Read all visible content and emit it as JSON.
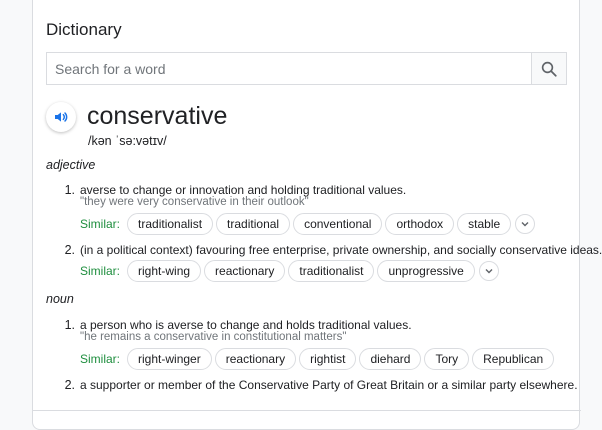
{
  "dictionary": {
    "title": "Dictionary",
    "search_placeholder": "Search for a word",
    "word": "conservative",
    "phonetic": "/kən ˈsə:vətɪv/",
    "similar_label": "Similar:",
    "entries": [
      {
        "pos": "adjective",
        "senses": [
          {
            "num": "1.",
            "definition": "averse to change or innovation and holding traditional values.",
            "example": "\"they were very conservative in their outlook\"",
            "similar": [
              "traditionalist",
              "traditional",
              "conventional",
              "orthodox",
              "stable"
            ]
          },
          {
            "num": "2.",
            "definition": "(in a political context) favouring free enterprise, private ownership, and socially conservative ideas.",
            "similar": [
              "right-wing",
              "reactionary",
              "traditionalist",
              "unprogressive"
            ]
          }
        ]
      },
      {
        "pos": "noun",
        "senses": [
          {
            "num": "1.",
            "definition": "a person who is averse to change and holds traditional values.",
            "example": "\"he remains a conservative in constitutional matters\"",
            "similar": [
              "right-winger",
              "reactionary",
              "rightist",
              "diehard",
              "Tory",
              "Republican"
            ]
          },
          {
            "num": "2.",
            "definition": "a supporter or member of the Conservative Party of Great Britain or a similar party elsewhere."
          }
        ]
      }
    ]
  },
  "icons": {
    "search": "search-icon",
    "speaker": "speaker-icon",
    "expand": "chevron-down-icon"
  },
  "colors": {
    "accent_blue": "#1a73e8",
    "similar_green": "#1e8e3e",
    "example_gray": "#70757a"
  }
}
